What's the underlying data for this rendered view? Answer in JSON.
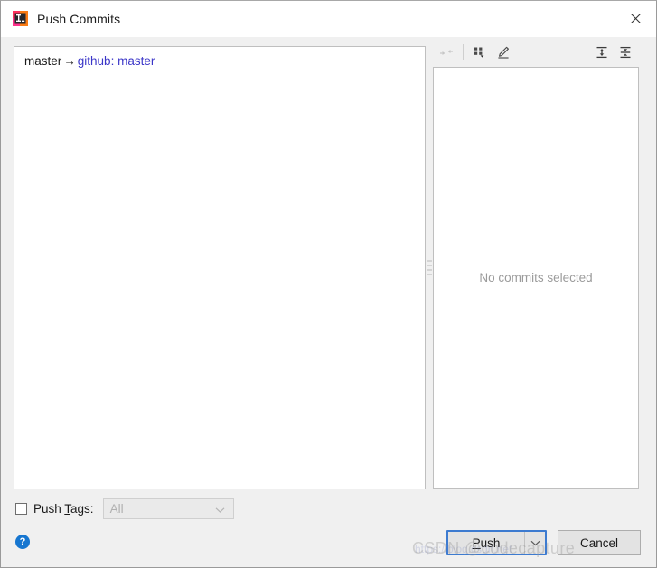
{
  "window": {
    "title": "Push Commits",
    "app_icon": "intellij-idea-icon",
    "close_label": "✕"
  },
  "left_panel": {
    "branch_row": {
      "local_branch": "master",
      "arrow": "→",
      "remote_name": "github",
      "separator": ":",
      "remote_branch": "master"
    }
  },
  "toolbar": {
    "buttons": [
      {
        "name": "collapse-selection-icon",
        "tooltip": "Collapse",
        "disabled": true
      },
      {
        "name": "group-by-icon",
        "tooltip": "Group By",
        "disabled": false
      },
      {
        "name": "edit-icon",
        "tooltip": "Edit",
        "disabled": false
      },
      {
        "name": "expand-all-icon",
        "tooltip": "Expand All",
        "disabled": false
      },
      {
        "name": "collapse-all-icon",
        "tooltip": "Collapse All",
        "disabled": false
      }
    ]
  },
  "right_panel": {
    "empty_message": "No commits selected"
  },
  "options": {
    "push_tags_checked": false,
    "push_tags_label_pre": "Push ",
    "push_tags_label_mnemonic": "T",
    "push_tags_label_post": "ags:",
    "tags_combo_value": "All",
    "tags_combo_disabled": true
  },
  "footer": {
    "help_glyph": "?",
    "push_label_pre": "",
    "push_label_mnemonic": "P",
    "push_label_post": "ush",
    "push_dropdown_glyph": "⌄",
    "cancel_label": "Cancel"
  },
  "watermark": {
    "text": "CSDN @codecapture",
    "url": "https://blog.csdn.net"
  },
  "colors": {
    "accent_blue": "#3d7bd0",
    "branch_remote": "#3b36c8",
    "help_blue": "#1676d0",
    "panel_bg": "#f0f0f0",
    "field_bg": "#ffffff"
  }
}
